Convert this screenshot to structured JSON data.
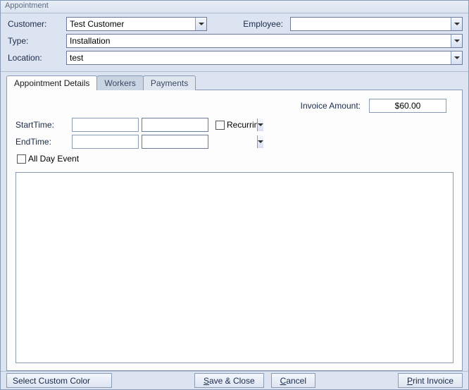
{
  "window": {
    "title": "Appointment"
  },
  "form": {
    "customer_label": "Customer:",
    "customer_value": "Test Customer",
    "employee_label": "Employee:",
    "employee_value": "",
    "type_label": "Type:",
    "type_value": "Installation",
    "location_label": "Location:",
    "location_value": "test"
  },
  "tabs": {
    "details": "Appointment Details",
    "workers": "Workers",
    "payments": "Payments"
  },
  "details": {
    "invoice_label": "Invoice Amount:",
    "invoice_value": "$60.00",
    "starttime_label": "StartTime:",
    "starttime_date": "",
    "starttime_time": "",
    "endtime_label": "EndTime:",
    "endtime_date": "",
    "endtime_time": "",
    "recurring_label": "Recurring",
    "allday_label": "All Day Event",
    "notes": ""
  },
  "buttons": {
    "color": "Select Custom Color",
    "save_prefix": "S",
    "save_rest": "ave & Close",
    "cancel_prefix": "C",
    "cancel_rest": "ancel",
    "print_prefix": "P",
    "print_rest": "rint Invoice"
  }
}
